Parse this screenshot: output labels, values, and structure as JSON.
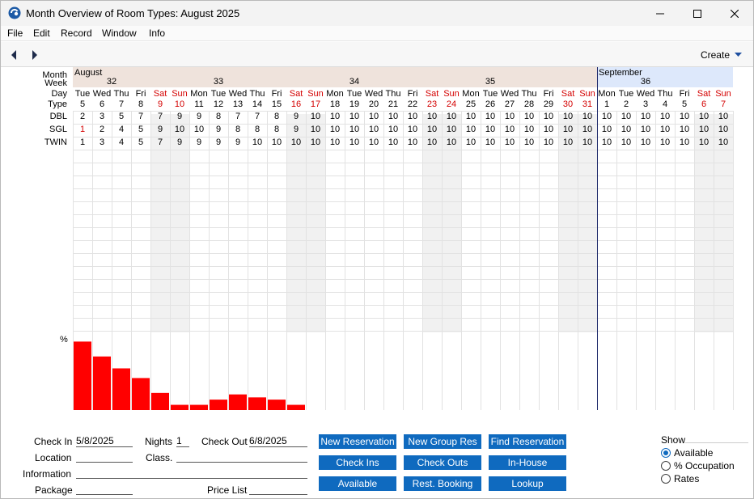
{
  "window": {
    "title": "Month Overview of Room Types: August 2025",
    "icon": "app-logo-icon",
    "controls": [
      "minimize-icon",
      "maximize-icon",
      "close-icon"
    ]
  },
  "menu": [
    "File",
    "Edit",
    "Record",
    "Window",
    "Info"
  ],
  "toolbar": {
    "prev_icon": "arrow-left-icon",
    "next_icon": "arrow-right-icon",
    "create_label": "Create"
  },
  "grid": {
    "row_labels": {
      "month": "Month",
      "week": "Week",
      "day": "Day",
      "type": "Type"
    },
    "months": [
      {
        "label": "August",
        "start": 0,
        "span": 27
      },
      {
        "label": "September",
        "start": 27,
        "span": 7
      }
    ],
    "weeks": [
      {
        "label": "32",
        "start": 0,
        "span": 4
      },
      {
        "label": "33",
        "start": 4,
        "span": 7
      },
      {
        "label": "34",
        "start": 11,
        "span": 7
      },
      {
        "label": "35",
        "start": 18,
        "span": 7
      },
      {
        "label": "36",
        "start": 25,
        "span": 9
      }
    ],
    "days": [
      "Tue",
      "Wed",
      "Thu",
      "Fri",
      "Sat",
      "Sun",
      "Mon",
      "Tue",
      "Wed",
      "Thu",
      "Fri",
      "Sat",
      "Sun",
      "Mon",
      "Tue",
      "Wed",
      "Thu",
      "Fri",
      "Sat",
      "Sun",
      "Mon",
      "Tue",
      "Wed",
      "Thu",
      "Fri",
      "Sat",
      "Sun",
      "Mon",
      "Tue",
      "Wed",
      "Thu",
      "Fri",
      "Sat",
      "Sun"
    ],
    "dates": [
      "5",
      "6",
      "7",
      "8",
      "9",
      "10",
      "11",
      "12",
      "13",
      "14",
      "15",
      "16",
      "17",
      "18",
      "19",
      "20",
      "21",
      "22",
      "23",
      "24",
      "25",
      "26",
      "27",
      "28",
      "29",
      "30",
      "31",
      "1",
      "2",
      "3",
      "4",
      "5",
      "6",
      "7"
    ],
    "weekend_columns": [
      4,
      5,
      11,
      12,
      18,
      19,
      25,
      26,
      32,
      33
    ],
    "rows": [
      {
        "type": "DBL",
        "values": [
          "2",
          "3",
          "5",
          "7",
          "7",
          "9",
          "9",
          "8",
          "7",
          "7",
          "8",
          "9",
          "10",
          "10",
          "10",
          "10",
          "10",
          "10",
          "10",
          "10",
          "10",
          "10",
          "10",
          "10",
          "10",
          "10",
          "10",
          "10",
          "10",
          "10",
          "10",
          "10",
          "10",
          "10"
        ]
      },
      {
        "type": "SGL",
        "values": [
          "1",
          "2",
          "4",
          "5",
          "9",
          "10",
          "10",
          "9",
          "8",
          "8",
          "8",
          "9",
          "10",
          "10",
          "10",
          "10",
          "10",
          "10",
          "10",
          "10",
          "10",
          "10",
          "10",
          "10",
          "10",
          "10",
          "10",
          "10",
          "10",
          "10",
          "10",
          "10",
          "10",
          "10"
        ],
        "red_index": 0
      },
      {
        "type": "TWIN",
        "values": [
          "1",
          "3",
          "4",
          "5",
          "7",
          "9",
          "9",
          "9",
          "9",
          "10",
          "10",
          "10",
          "10",
          "10",
          "10",
          "10",
          "10",
          "10",
          "10",
          "10",
          "10",
          "10",
          "10",
          "10",
          "10",
          "10",
          "10",
          "10",
          "10",
          "10",
          "10",
          "10",
          "10",
          "10"
        ]
      }
    ]
  },
  "chart_data": {
    "type": "bar",
    "ylabel": "%",
    "ylim": [
      0,
      100
    ],
    "categories": [
      "5",
      "6",
      "7",
      "8",
      "9",
      "10",
      "11",
      "12",
      "13",
      "14",
      "15",
      "16",
      "17",
      "18",
      "19",
      "20",
      "21",
      "22",
      "23",
      "24",
      "25",
      "26",
      "27",
      "28",
      "29",
      "30",
      "31",
      "1",
      "2",
      "3",
      "4",
      "5",
      "6",
      "7"
    ],
    "values": [
      92,
      72,
      56,
      43,
      23,
      7,
      7,
      14,
      21,
      17,
      14,
      7,
      0,
      0,
      0,
      0,
      0,
      0,
      0,
      0,
      0,
      0,
      0,
      0,
      0,
      0,
      0,
      0,
      0,
      0,
      0,
      0,
      0,
      0
    ],
    "bar_color": "#ff0000"
  },
  "form": {
    "check_in_label": "Check In",
    "check_in_value": "5/8/2025",
    "nights_label": "Nights",
    "nights_value": "1",
    "check_out_label": "Check Out",
    "check_out_value": "6/8/2025",
    "location_label": "Location",
    "location_value": "",
    "class_label": "Class.",
    "class_value": "",
    "information_label": "Information",
    "information_value": "",
    "package_label": "Package",
    "package_value": "",
    "price_list_label": "Price List",
    "price_list_value": ""
  },
  "buttons": {
    "new_reservation": "New Reservation",
    "new_group_res": "New Group Res",
    "find_reservation": "Find Reservation",
    "check_ins": "Check Ins",
    "check_outs": "Check Outs",
    "in_house": "In-House",
    "available": "Available",
    "rest_booking": "Rest. Booking",
    "lookup": "Lookup"
  },
  "show": {
    "label": "Show",
    "options": [
      "Available",
      "% Occupation",
      "Rates"
    ],
    "selected": "Available"
  },
  "colors": {
    "august_band": "#efe3dc",
    "september_band": "#dde8fb",
    "weekend_shade": "#f1f1f1",
    "weekend_text": "#d40000",
    "button_blue": "#0f6abf",
    "today_line": "#1f2a6b"
  }
}
